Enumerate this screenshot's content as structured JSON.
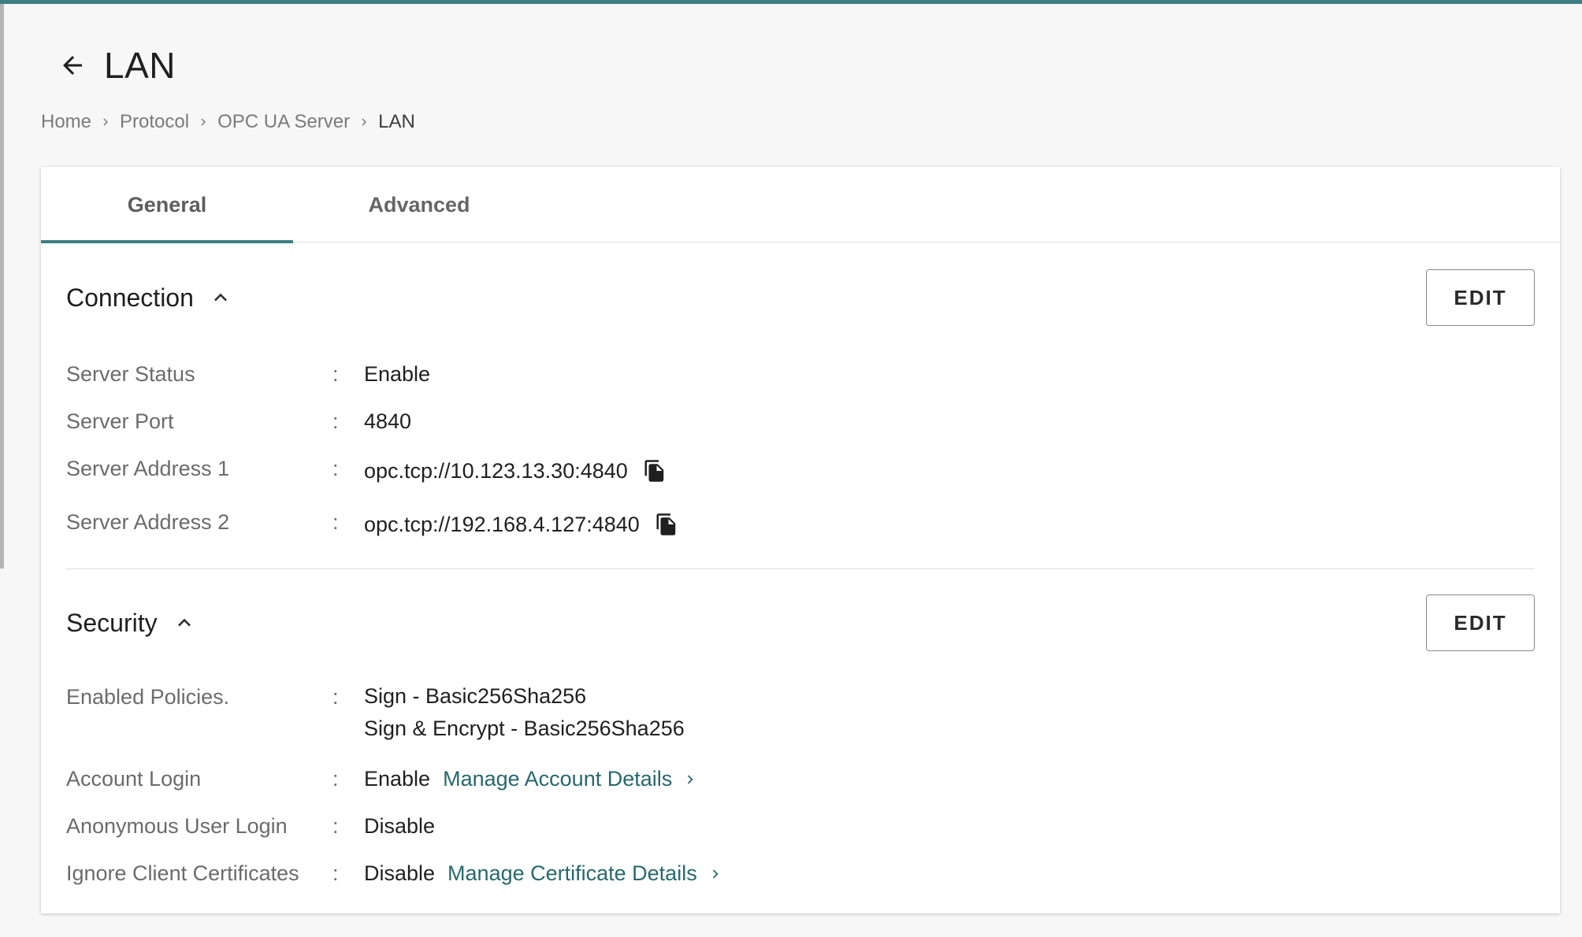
{
  "page": {
    "title": "LAN",
    "back_icon": "arrow-left-icon"
  },
  "breadcrumb": {
    "items": [
      "Home",
      "Protocol",
      "OPC UA Server"
    ],
    "current": "LAN",
    "separator_icon": "chevron-right-icon"
  },
  "tabs": [
    {
      "label": "General",
      "active": true
    },
    {
      "label": "Advanced",
      "active": false
    }
  ],
  "connection": {
    "title": "Connection",
    "edit_label": "EDIT",
    "rows": {
      "server_status": {
        "label": "Server Status",
        "value": "Enable"
      },
      "server_port": {
        "label": "Server Port",
        "value": "4840"
      },
      "server_address_1": {
        "label": "Server Address 1",
        "value": "opc.tcp://10.123.13.30:4840"
      },
      "server_address_2": {
        "label": "Server Address 2",
        "value": "opc.tcp://192.168.4.127:4840"
      }
    }
  },
  "security": {
    "title": "Security",
    "edit_label": "EDIT",
    "rows": {
      "enabled_policies": {
        "label": "Enabled Policies.",
        "values": [
          "Sign - Basic256Sha256",
          "Sign & Encrypt - Basic256Sha256"
        ]
      },
      "account_login": {
        "label": "Account Login",
        "value": "Enable",
        "link": "Manage Account Details"
      },
      "anonymous_login": {
        "label": "Anonymous User Login",
        "value": "Disable"
      },
      "ignore_client_certs": {
        "label": "Ignore Client Certificates",
        "value": "Disable",
        "link": "Manage Certificate Details"
      }
    }
  },
  "colon": ":",
  "colors": {
    "accent": "#3d7f82",
    "link": "#27686b"
  }
}
